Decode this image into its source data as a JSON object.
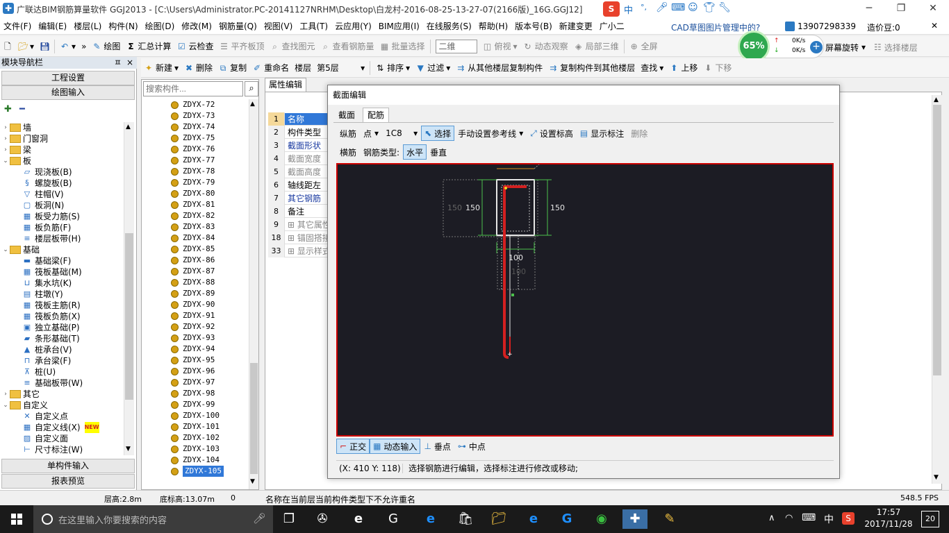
{
  "window": {
    "title": "广联达BIM钢筋算量软件 GGJ2013 - [C:\\Users\\Administrator.PC-20141127NRHM\\Desktop\\白龙村-2016-08-25-13-27-07(2166版)_16G.GGJ12]",
    "minimize": "─",
    "maximize": "❐",
    "close": "✕"
  },
  "ime": {
    "label": "中",
    "dots": "°,"
  },
  "menu": [
    "文件(F)",
    "编辑(E)",
    "楼层(L)",
    "构件(N)",
    "绘图(D)",
    "修改(M)",
    "钢筋量(Q)",
    "视图(V)",
    "工具(T)",
    "云应用(Y)",
    "BIM应用(I)",
    "在线服务(S)",
    "帮助(H)",
    "版本号(B)",
    "新建变更",
    "广小二"
  ],
  "menu_right": {
    "cad_note": "CAD草图图片管理中的?",
    "phone": "13907298339",
    "price_bean": "造价豆:0"
  },
  "toolbar1": {
    "draw": "绘图",
    "summary": "汇总计算",
    "cloud_check": "云检查",
    "level_top": "平齐板顶",
    "find_element": "查找图元",
    "view_rebar": "查看钢筋量",
    "batch_select": "批量选择",
    "view_mode": "二维",
    "top_view": "俯视",
    "dynamic_view": "动态观察",
    "local_3d": "局部三维",
    "fullscreen": "全屏",
    "rotate": "屏幕旋转",
    "select_floor": "选择楼层"
  },
  "speed": {
    "percent": "65%",
    "up": "0K/s",
    "down": "0K/s"
  },
  "toolbar2": {
    "new": "新建",
    "delete": "删除",
    "copy": "复制",
    "rename": "重命名",
    "floor_label": "楼层",
    "floor_value": "第5层",
    "sort": "排序",
    "filter": "过滤",
    "copy_from": "从其他楼层复制构件",
    "copy_to": "复制构件到其他楼层",
    "find": "查找",
    "move_up": "上移",
    "move_down": "下移"
  },
  "nav": {
    "header": "模块导航栏",
    "pin": "ㅍ",
    "close": "×",
    "project_settings": "工程设置",
    "draw_input": "绘图输入",
    "single_input": "单构件输入",
    "report": "报表预览",
    "tree": [
      {
        "label": "墙",
        "type": "folder",
        "level": 0,
        "exp": "›"
      },
      {
        "label": "门窗洞",
        "type": "folder",
        "level": 0,
        "exp": "›"
      },
      {
        "label": "梁",
        "type": "folder",
        "level": 0,
        "exp": "›"
      },
      {
        "label": "板",
        "type": "folder",
        "level": 0,
        "exp": "⌄"
      },
      {
        "label": "现浇板(B)",
        "type": "item",
        "level": 1
      },
      {
        "label": "螺旋板(B)",
        "type": "item",
        "level": 1
      },
      {
        "label": "柱帽(V)",
        "type": "item",
        "level": 1
      },
      {
        "label": "板洞(N)",
        "type": "item",
        "level": 1
      },
      {
        "label": "板受力筋(S)",
        "type": "item",
        "level": 1
      },
      {
        "label": "板负筋(F)",
        "type": "item",
        "level": 1
      },
      {
        "label": "楼层板带(H)",
        "type": "item",
        "level": 1
      },
      {
        "label": "基础",
        "type": "folder",
        "level": 0,
        "exp": "⌄"
      },
      {
        "label": "基础梁(F)",
        "type": "item",
        "level": 1
      },
      {
        "label": "筏板基础(M)",
        "type": "item",
        "level": 1
      },
      {
        "label": "集水坑(K)",
        "type": "item",
        "level": 1
      },
      {
        "label": "柱墩(Y)",
        "type": "item",
        "level": 1
      },
      {
        "label": "筏板主筋(R)",
        "type": "item",
        "level": 1
      },
      {
        "label": "筏板负筋(X)",
        "type": "item",
        "level": 1
      },
      {
        "label": "独立基础(P)",
        "type": "item",
        "level": 1
      },
      {
        "label": "条形基础(T)",
        "type": "item",
        "level": 1
      },
      {
        "label": "桩承台(V)",
        "type": "item",
        "level": 1
      },
      {
        "label": "承台梁(F)",
        "type": "item",
        "level": 1
      },
      {
        "label": "桩(U)",
        "type": "item",
        "level": 1
      },
      {
        "label": "基础板带(W)",
        "type": "item",
        "level": 1
      },
      {
        "label": "其它",
        "type": "folder",
        "level": 0,
        "exp": "›"
      },
      {
        "label": "自定义",
        "type": "folder",
        "level": 0,
        "exp": "⌄"
      },
      {
        "label": "自定义点",
        "type": "item",
        "level": 1
      },
      {
        "label": "自定义线(X)",
        "type": "item",
        "level": 1,
        "badge": "NEW"
      },
      {
        "label": "自定义面",
        "type": "item",
        "level": 1
      },
      {
        "label": "尺寸标注(W)",
        "type": "item",
        "level": 1
      }
    ]
  },
  "search": {
    "placeholder": "搜索构件..."
  },
  "components": [
    "ZDYX-72",
    "ZDYX-73",
    "ZDYX-74",
    "ZDYX-75",
    "ZDYX-76",
    "ZDYX-77",
    "ZDYX-78",
    "ZDYX-79",
    "ZDYX-80",
    "ZDYX-81",
    "ZDYX-82",
    "ZDYX-83",
    "ZDYX-84",
    "ZDYX-85",
    "ZDYX-86",
    "ZDYX-87",
    "ZDYX-88",
    "ZDYX-89",
    "ZDYX-90",
    "ZDYX-91",
    "ZDYX-92",
    "ZDYX-93",
    "ZDYX-94",
    "ZDYX-95",
    "ZDYX-96",
    "ZDYX-97",
    "ZDYX-98",
    "ZDYX-99",
    "ZDYX-100",
    "ZDYX-101",
    "ZDYX-102",
    "ZDYX-103",
    "ZDYX-104",
    "ZDYX-105"
  ],
  "selected_component": "ZDYX-105",
  "property": {
    "tab": "属性编辑",
    "rows": [
      {
        "num": "1",
        "name": "名称"
      },
      {
        "num": "2",
        "name": "构件类型"
      },
      {
        "num": "3",
        "name": "截面形状"
      },
      {
        "num": "4",
        "name": "截面宽度"
      },
      {
        "num": "5",
        "name": "截面高度"
      },
      {
        "num": "6",
        "name": "轴线距左"
      },
      {
        "num": "7",
        "name": "其它钢筋"
      },
      {
        "num": "8",
        "name": "备注"
      },
      {
        "num": "9",
        "name": "其它属性"
      },
      {
        "num": "18",
        "name": "锚固搭接"
      },
      {
        "num": "33",
        "name": "显示样式"
      }
    ]
  },
  "dialog": {
    "title": "截面编辑",
    "close": "✕",
    "tabs": [
      "截面",
      "配筋"
    ],
    "active_tab": "配筋",
    "row1": {
      "longitudinal": "纵筋",
      "point": "点",
      "spec": "1C8",
      "select": "选择",
      "manual_ref": "手动设置参考线",
      "set_elev": "设置标高",
      "show_label": "显示标注",
      "delete": "删除"
    },
    "row2": {
      "stirrup": "横筋",
      "rebar_type": "钢筋类型:",
      "horizontal": "水平",
      "vertical": "垂直"
    },
    "canvas": {
      "dim_left_outer": "150",
      "dim_left": "150",
      "dim_right": "150",
      "dim_bottom": "100",
      "dim_bottom_faded": "100"
    },
    "row3": {
      "ortho": "正交",
      "dynamic_input": "动态输入",
      "perp": "垂点",
      "mid": "中点"
    },
    "status_coords": "(X: 410 Y: 118)",
    "status_msg": "选择钢筋进行编辑，选择标注进行修改或移动;"
  },
  "statusbar": {
    "floor_height": "层高:2.8m",
    "bottom_elev": "底标高:13.07m",
    "zero": "0",
    "message": "名称在当前层当前构件类型下不允许重名",
    "fps": "548.5 FPS"
  },
  "taskbar": {
    "search_placeholder": "在这里输入你要搜索的内容",
    "time": "17:57",
    "date": "2017/11/28",
    "ime": "中",
    "notif": "20"
  },
  "colors": {
    "accent": "#2b79c2",
    "canvas_bg": "#1c1c24",
    "rebar": "#d42020",
    "dim": "#4cc04c",
    "border_red": "#cc0000"
  }
}
